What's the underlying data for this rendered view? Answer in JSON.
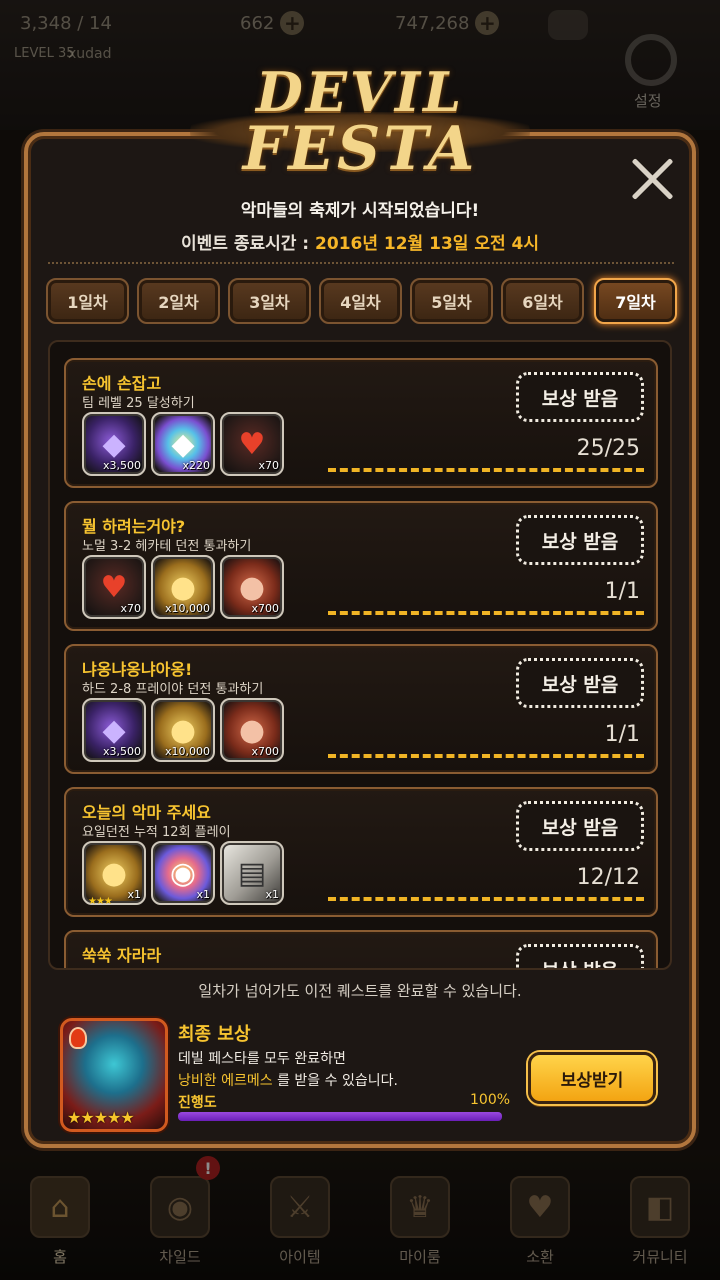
{
  "topbar": {
    "resource1": "3,348 / 14",
    "resource2": "662",
    "resource3": "747,268",
    "level_label": "LEVEL 35",
    "nickname": "xudad",
    "settings_label": "설정"
  },
  "event": {
    "logo_line1": "DEVIL",
    "logo_line2": "FESTA",
    "headline": "악마들의 축제가 시작되었습니다!",
    "end_label": "이벤트 종료시간 : ",
    "end_value": "2016년 12월 13일 오전 4시"
  },
  "tabs": [
    {
      "label": "1일차"
    },
    {
      "label": "2일차"
    },
    {
      "label": "3일차"
    },
    {
      "label": "4일차"
    },
    {
      "label": "5일차"
    },
    {
      "label": "6일차"
    },
    {
      "label": "7일차",
      "active": true
    }
  ],
  "quests": [
    {
      "title": "손에 손잡고",
      "desc": "팀 레벨 25 달성하기",
      "button": "보상 받음",
      "progress": "25/25",
      "rewards": [
        {
          "icon": "purple-gem-icon",
          "count": "x3,500"
        },
        {
          "icon": "rainbow-gem-icon",
          "count": "x220"
        },
        {
          "icon": "heart-icon",
          "count": "x70"
        }
      ]
    },
    {
      "title": "뭘 하려는거야?",
      "desc": "노멀 3-2 헤카테 던전 통과하기",
      "button": "보상 받음",
      "progress": "1/1",
      "rewards": [
        {
          "icon": "heart-icon",
          "count": "x70"
        },
        {
          "icon": "gold-coin-icon",
          "count": "x10,000"
        },
        {
          "icon": "copper-coin-icon",
          "count": "x700"
        }
      ]
    },
    {
      "title": "냐옹냐옹냐아옹!",
      "desc": "하드 2-8 프레이야 던전 통과하기",
      "button": "보상 받음",
      "progress": "1/1",
      "rewards": [
        {
          "icon": "purple-gem-icon",
          "count": "x3,500"
        },
        {
          "icon": "gold-coin-icon",
          "count": "x10,000"
        },
        {
          "icon": "copper-coin-icon",
          "count": "x700"
        }
      ]
    },
    {
      "title": "오늘의 악마 주세요",
      "desc": "요일던전 누적 12회 플레이",
      "button": "보상 받음",
      "progress": "12/12",
      "rewards": [
        {
          "icon": "gold-coin-pile-icon",
          "count": "x1"
        },
        {
          "icon": "rainbow-orb-icon",
          "count": "x1"
        },
        {
          "icon": "ticket-icon",
          "count": "x1"
        }
      ]
    },
    {
      "title": "쑥쑥 자라라",
      "desc": "",
      "button": "보상 받음",
      "progress": "",
      "rewards": []
    }
  ],
  "hint": "일차가 넘어가도 이전 퀘스트를 완료할 수 있습니다.",
  "final": {
    "title": "최종 보상",
    "line1": "데빌 페스타를 모두 완료하면",
    "line2_highlight": "낭비한 에르메스",
    "line2_rest": " 를 받을 수 있습니다.",
    "progress_label": "진행도",
    "progress_pct": "100%",
    "progress_value": 1.0,
    "button": "보상받기"
  },
  "nav": [
    {
      "label": "홈",
      "icon": "home-icon"
    },
    {
      "label": "차일드",
      "icon": "flame-icon"
    },
    {
      "label": "아이템",
      "icon": "sword-shield-icon"
    },
    {
      "label": "마이룸",
      "icon": "crown-icon"
    },
    {
      "label": "소환",
      "icon": "potion-icon"
    },
    {
      "label": "커뮤니티",
      "icon": "shield-icon"
    }
  ],
  "colors": {
    "accent_gold": "#f7c430",
    "frame_bronze": "#b2763d",
    "progress_purple": "#7d2fd0",
    "end_time": "#f6b628"
  }
}
